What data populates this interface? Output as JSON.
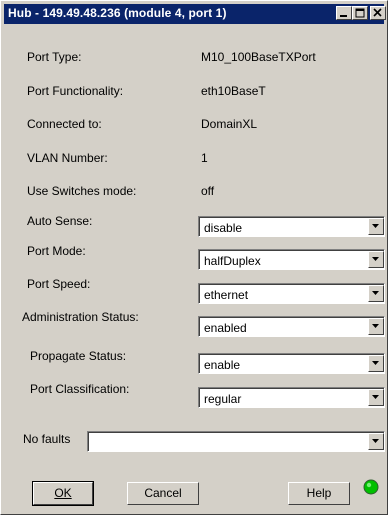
{
  "window": {
    "title": "Hub - 149.49.48.236 (module 4, port 1)",
    "title_buttons": [
      "minimize-icon",
      "maximize-icon",
      "close-icon"
    ]
  },
  "info": {
    "port_type": {
      "label": "Port Type:",
      "value": "M10_100BaseTXPort"
    },
    "port_functionality": {
      "label": "Port Functionality:",
      "value": "eth10BaseT"
    },
    "connected_to": {
      "label": "Connected to:",
      "value": "DomainXL"
    },
    "vlan_number": {
      "label": "VLAN Number:",
      "value": "1"
    },
    "use_switches_mode": {
      "label": "Use Switches mode:",
      "value": "off"
    }
  },
  "settings": {
    "auto_sense": {
      "label": "Auto Sense:",
      "value": "disable"
    },
    "port_mode": {
      "label": "Port Mode:",
      "value": "halfDuplex"
    },
    "port_speed": {
      "label": "Port Speed:",
      "value": "ethernet"
    },
    "admin_status": {
      "label": "Administration Status:",
      "value": "enabled"
    },
    "propagate_status": {
      "label": "Propagate Status:",
      "value": "enable"
    },
    "port_classification": {
      "label": "Port Classification:",
      "value": "regular"
    }
  },
  "faults": {
    "label": "No faults",
    "value": ""
  },
  "buttons": {
    "ok": "OK",
    "cancel": "Cancel",
    "help": "Help"
  },
  "status_led": {
    "icon": "status-led-icon",
    "color": "#00c000"
  }
}
